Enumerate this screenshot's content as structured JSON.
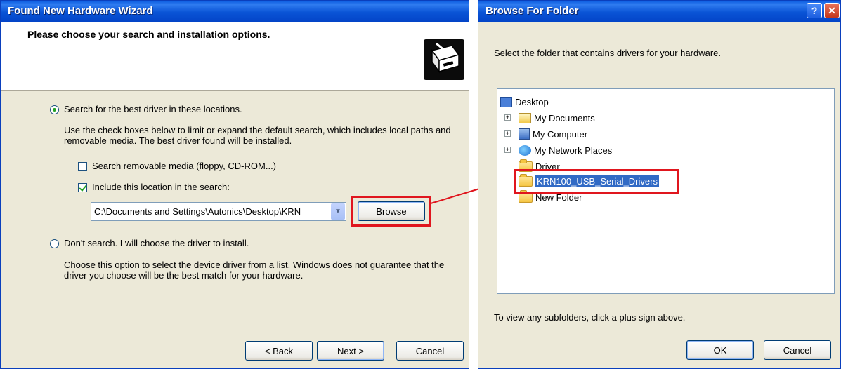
{
  "wizard": {
    "title": "Found New Hardware Wizard",
    "heading": "Please choose your search and installation options.",
    "icon": "hardware-install-icon",
    "option_search": {
      "label": "Search for the best driver in these locations.",
      "selected": true,
      "description": "Use the check boxes below to limit or expand the default search, which includes local paths and removable media. The best driver found will be installed."
    },
    "checkbox_removable": {
      "label": "Search removable media (floppy, CD-ROM...)",
      "checked": false
    },
    "checkbox_location": {
      "label": "Include this location in the search:",
      "checked": true
    },
    "location_path": "C:\\Documents and Settings\\Autonics\\Desktop\\KRN",
    "browse_label": "Browse",
    "option_dont_search": {
      "label": "Don't search. I will choose the driver to install.",
      "selected": false,
      "description": "Choose this option to select the device driver from a list.  Windows does not guarantee that the driver you choose will be the best match for your hardware."
    },
    "buttons": {
      "back": "< Back",
      "next": "Next >",
      "cancel": "Cancel"
    }
  },
  "browse_dialog": {
    "title": "Browse For Folder",
    "help_glyph": "?",
    "close_glyph": "✕",
    "instruction": "Select the folder that contains drivers for your hardware.",
    "tree": [
      {
        "label": "Desktop",
        "icon": "desktop-icon"
      },
      {
        "label": "My Documents",
        "icon": "my-documents-icon",
        "expandable": true
      },
      {
        "label": "My Computer",
        "icon": "my-computer-icon",
        "expandable": true
      },
      {
        "label": "My Network Places",
        "icon": "network-places-icon",
        "expandable": true
      },
      {
        "label": "Driver",
        "icon": "folder-icon"
      },
      {
        "label": "KRN100_USB_Serial_Drivers",
        "icon": "folder-icon",
        "selected": true
      },
      {
        "label": "New Folder",
        "icon": "folder-icon"
      }
    ],
    "hint": "To view any subfolders, click a plus sign above.",
    "buttons": {
      "ok": "OK",
      "cancel": "Cancel"
    }
  },
  "colors": {
    "titlebar": "#0a54d6",
    "dialog_bg": "#ece9d8",
    "highlight": "#e0161e",
    "selection": "#316ac5"
  }
}
